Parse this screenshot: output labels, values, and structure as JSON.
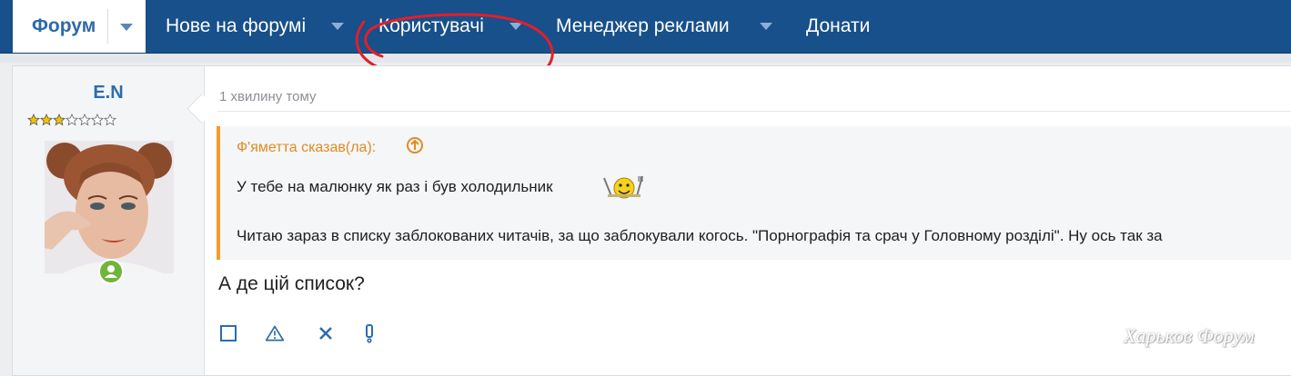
{
  "nav": {
    "items": [
      {
        "label": "Форум",
        "active": true,
        "has_menu": true
      },
      {
        "label": "Нове на форумі",
        "has_menu": true
      },
      {
        "label": "Користувачі",
        "has_menu": true
      },
      {
        "label": "Менеджер реклами",
        "has_menu": true
      },
      {
        "label": "Донати",
        "has_menu": false
      }
    ]
  },
  "post": {
    "username": "E.N",
    "rating_stars": {
      "filled": 3,
      "total": 7
    },
    "online": true,
    "time": "1 хвилину тому",
    "quote": {
      "author_line": "Ф'яметта сказав(ла):",
      "line1": "У тебе на малюнку як раз і був холодильник",
      "line2": "Читаю зараз в списку заблокованих читачів, за що заблокували когось. \"Порнографія та срач у Головному розділі\". Ну ось так за"
    },
    "text": "А де цій список?",
    "actions": [
      "checkbox-icon",
      "warning-icon",
      "close-icon",
      "exclamation-icon"
    ]
  },
  "watermark": "Харьков Форум",
  "colors": {
    "nav_bg": "#17508a",
    "quote_accent": "#f39c2c",
    "username": "#2e6cab",
    "online": "#6fb53a"
  }
}
